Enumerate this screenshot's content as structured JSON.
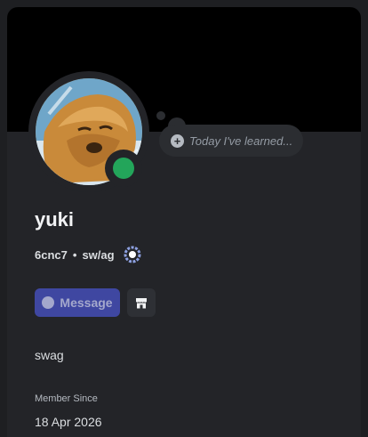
{
  "profile": {
    "display_name": "yuki",
    "username": "6cnc7",
    "separator": "•",
    "pronouns": "sw/ag",
    "status": "online",
    "thought_placeholder": "Today I've learned...",
    "bio": "swag",
    "member_since_label": "Member Since",
    "member_since_date": "18 Apr 2026"
  },
  "actions": {
    "message_label": "Message"
  },
  "icons": {
    "avatar": "dog-avatar",
    "status": "online-status-icon",
    "add": "plus-circle-icon",
    "badge": "nitro-badge-icon",
    "message": "chat-bubble-icon",
    "shop": "shop-icon"
  },
  "colors": {
    "background": "#232428",
    "banner": "#000000",
    "status_online": "#23a55a",
    "message_button": "#4752c4",
    "badge": "#8ea1e1"
  }
}
